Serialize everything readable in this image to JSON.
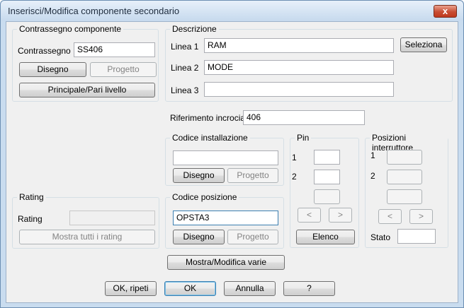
{
  "window": {
    "title": "Inserisci/Modifica componente secondario",
    "close_glyph": "x"
  },
  "contrassegno": {
    "group_title": "Contrassegno componente",
    "label": "Contrassegno",
    "value": "SS406",
    "disegno": "Disegno",
    "progetto": "Progetto",
    "principale": "Principale/Pari livello"
  },
  "descrizione": {
    "group_title": "Descrizione",
    "linea1_label": "Linea 1",
    "linea1_value": "RAM",
    "linea2_label": "Linea 2",
    "linea2_value": "MODE",
    "linea3_label": "Linea 3",
    "linea3_value": "",
    "seleziona": "Seleziona"
  },
  "riferimento": {
    "label": "Riferimento incrociato",
    "value": "406"
  },
  "installazione": {
    "group_title": "Codice installazione",
    "value": "",
    "disegno": "Disegno",
    "progetto": "Progetto"
  },
  "posizione": {
    "group_title": "Codice posizione",
    "value": "OPSTA3",
    "disegno": "Disegno",
    "progetto": "Progetto"
  },
  "pin": {
    "group_title": "Pin",
    "label1": "1",
    "label2": "2",
    "value1": "",
    "value2": "",
    "prev": "<",
    "next": ">",
    "elenco": "Elenco"
  },
  "interruttore": {
    "group_title": "Posizioni interruttore",
    "label1": "1",
    "label2": "2",
    "prev": "<",
    "next": ">",
    "stato_label": "Stato",
    "stato_value": ""
  },
  "rating": {
    "group_title": "Rating",
    "label": "Rating",
    "value": "",
    "mostra": "Mostra tutti i rating"
  },
  "footer": {
    "mostra_varie": "Mostra/Modifica varie",
    "ok_ripeti": "OK, ripeti",
    "ok": "OK",
    "annulla": "Annulla",
    "help": "?"
  }
}
